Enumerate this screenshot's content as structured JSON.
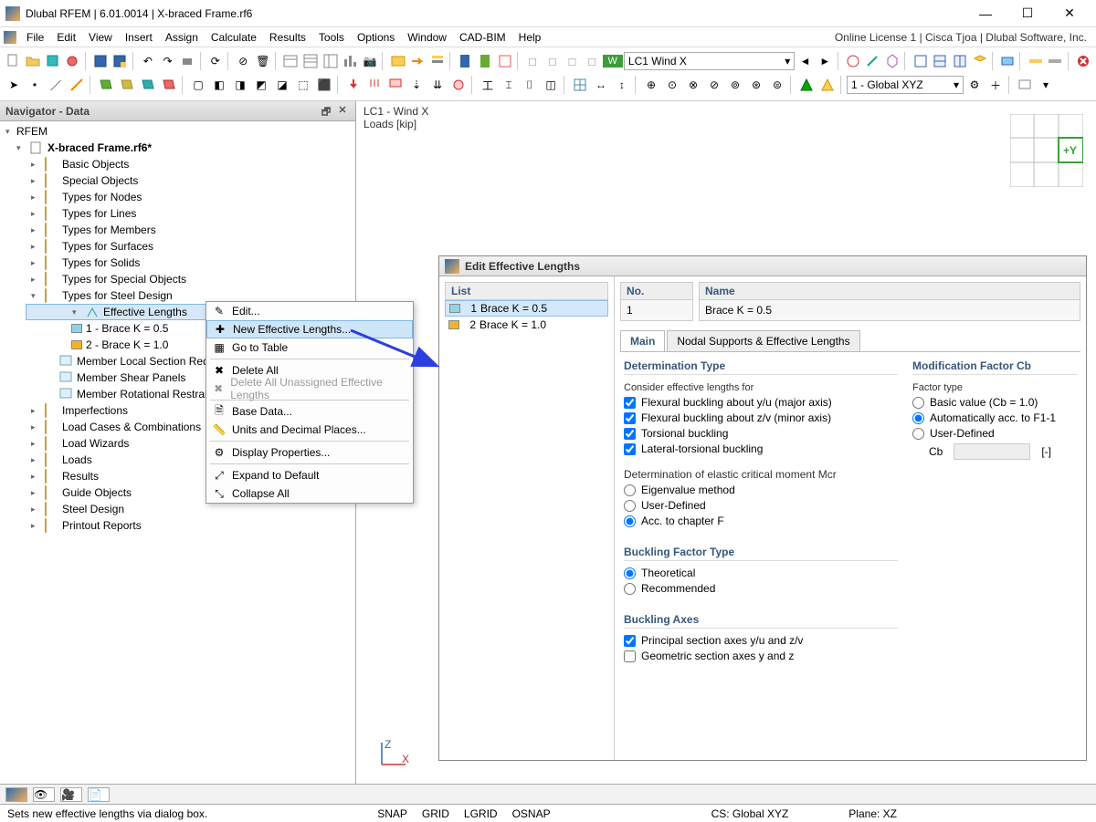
{
  "title": "Dlubal RFEM | 6.01.0014 | X-braced Frame.rf6",
  "license_text": "Online License 1 | Cisca Tjoa | Dlubal Software, Inc.",
  "menu": [
    "File",
    "Edit",
    "View",
    "Insert",
    "Assign",
    "Calculate",
    "Results",
    "Tools",
    "Options",
    "Window",
    "CAD-BIM",
    "Help"
  ],
  "load_case_badge": "W",
  "load_case_combo": "LC1   Wind X",
  "cs_combo": "  1 - Global XYZ",
  "navigator": {
    "title": "Navigator - Data",
    "root": "RFEM",
    "file": "X-braced Frame.rf6*",
    "items": [
      "Basic Objects",
      "Special Objects",
      "Types for Nodes",
      "Types for Lines",
      "Types for Members",
      "Types for Surfaces",
      "Types for Solids",
      "Types for Special Objects"
    ],
    "steel": "Types for Steel Design",
    "eff": "Effective Lengths",
    "eff_children": [
      "1 - Brace K = 0.5",
      "2 - Brace K = 1.0"
    ],
    "eff_child_colors": [
      "#8fd3e8",
      "#f0b429"
    ],
    "steel_rest": [
      "Member Local Section Reduct",
      "Member Shear Panels",
      "Member Rotational Restraints"
    ],
    "rest": [
      "Imperfections",
      "Load Cases & Combinations",
      "Load Wizards",
      "Loads",
      "Results",
      "Guide Objects",
      "Steel Design",
      "Printout Reports"
    ]
  },
  "work": {
    "lc": "LC1 - Wind X",
    "units": "Loads [kip]"
  },
  "ctx": {
    "items": [
      {
        "label": "Edit...",
        "icon": "pencil"
      },
      {
        "label": "New Effective Lengths...",
        "icon": "plus",
        "hl": true
      },
      {
        "label": "Go to Table",
        "icon": "table"
      },
      {
        "sep": true
      },
      {
        "label": "Delete All",
        "icon": "x"
      },
      {
        "label": "Delete All Unassigned Effective Lengths",
        "icon": "x",
        "disabled": true
      },
      {
        "sep": true
      },
      {
        "label": "Base Data...",
        "icon": "doc"
      },
      {
        "label": "Units and Decimal Places...",
        "icon": "ruler"
      },
      {
        "sep": true
      },
      {
        "label": "Display Properties...",
        "icon": "props"
      },
      {
        "sep": true
      },
      {
        "label": "Expand to Default",
        "icon": "expand"
      },
      {
        "label": "Collapse All",
        "icon": "collapse"
      }
    ]
  },
  "dialog": {
    "title": "Edit Effective Lengths",
    "list_header": "List",
    "no_header": "No.",
    "name_header": "Name",
    "no_val": "1",
    "name_val": "Brace K = 0.5",
    "list": [
      {
        "n": "1",
        "label": "Brace K = 0.5",
        "color": "#8fd3e8",
        "sel": true
      },
      {
        "n": "2",
        "label": "Brace K = 1.0",
        "color": "#f0b429"
      }
    ],
    "tabs": [
      "Main",
      "Nodal Supports & Effective Lengths"
    ],
    "det_type_h": "Determination Type",
    "consider_h": "Consider effective lengths for",
    "chk": [
      "Flexural buckling about y/u (major axis)",
      "Flexural buckling about z/v (minor axis)",
      "Torsional buckling",
      "Lateral-torsional buckling"
    ],
    "mcr_h": "Determination of elastic critical moment Mcr",
    "mcr_opts": [
      "Eigenvalue method",
      "User-Defined",
      "Acc. to chapter F"
    ],
    "mcr_sel": 2,
    "bf_h": "Buckling Factor Type",
    "bf_opts": [
      "Theoretical",
      "Recommended"
    ],
    "bf_sel": 0,
    "ba_h": "Buckling Axes",
    "ba_chk": [
      "Principal section axes y/u and z/v",
      "Geometric section axes y and z"
    ],
    "ba_chk_state": [
      true,
      false
    ],
    "cb_h": "Modification Factor Cb",
    "cb_ft": "Factor type",
    "cb_opts": [
      "Basic value (Cb = 1.0)",
      "Automatically acc. to F1-1",
      "User-Defined"
    ],
    "cb_sel": 1,
    "cb_label": "Cb",
    "cb_unit": "[-]"
  },
  "status": {
    "hint": "Sets new effective lengths via dialog box.",
    "snap": "SNAP",
    "grid": "GRID",
    "lgrid": "LGRID",
    "osnap": "OSNAP",
    "cs": "CS: Global XYZ",
    "plane": "Plane: XZ"
  },
  "mini_axis": "+Y"
}
